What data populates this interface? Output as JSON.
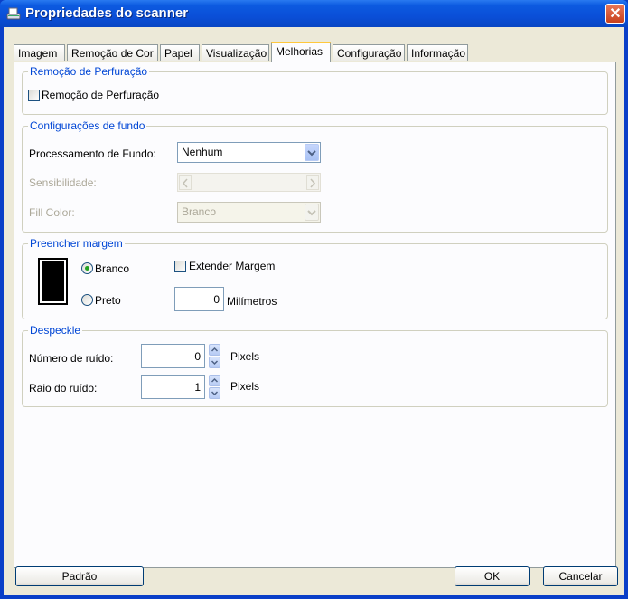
{
  "window": {
    "title": "Propriedades do scanner",
    "close_glyph": "✕"
  },
  "tabs": [
    {
      "label": "Imagem"
    },
    {
      "label": "Remoção de Cor"
    },
    {
      "label": "Papel"
    },
    {
      "label": "Visualização"
    },
    {
      "label": "Melhorias"
    },
    {
      "label": "Configuração"
    },
    {
      "label": "Informação"
    }
  ],
  "active_tab": "Melhorias",
  "perfuracao": {
    "group_label": "Remoção de Perfuração",
    "checkbox_label": "Remoção de Perfuração",
    "checked": false
  },
  "fundo": {
    "group_label": "Configurações de fundo",
    "processamento_label": "Processamento de Fundo:",
    "processamento_value": "Nenhum",
    "sensibilidade_label": "Sensibilidade:",
    "fill_color_label": "Fill Color:",
    "fill_color_value": "Branco"
  },
  "margem": {
    "group_label": "Preencher margem",
    "radio_branco": "Branco",
    "radio_preto": "Preto",
    "selected": "Branco",
    "extender_label": "Extender Margem",
    "extender_checked": false,
    "milimetros_value": "0",
    "milimetros_unit": "Milímetros"
  },
  "despeckle": {
    "group_label": "Despeckle",
    "numero_label": "Número de ruído:",
    "numero_value": "0",
    "numero_unit": "Pixels",
    "raio_label": "Raio do ruído:",
    "raio_value": "1",
    "raio_unit": "Pixels"
  },
  "buttons": {
    "padrao": "Padrão",
    "ok": "OK",
    "cancelar": "Cancelar"
  },
  "colors": {
    "accent": "#0046d5",
    "titlebar": "#0a4fd8",
    "tab_highlight": "#ffc83c"
  }
}
